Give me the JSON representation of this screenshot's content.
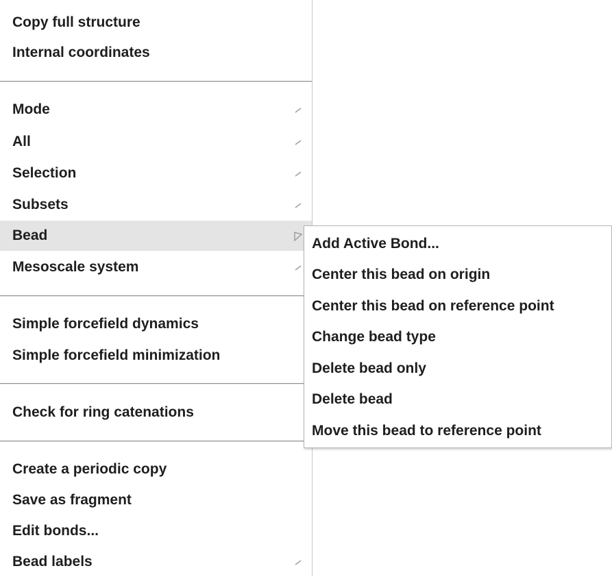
{
  "main_menu": {
    "items": [
      {
        "label": "Copy full structure"
      },
      {
        "label": "Internal coordinates"
      },
      {
        "label": "Mode",
        "submenu": true
      },
      {
        "label": "All",
        "submenu": true
      },
      {
        "label": "Selection",
        "submenu": true
      },
      {
        "label": "Subsets",
        "submenu": true
      },
      {
        "label": "Bead",
        "submenu": true,
        "highlighted": true
      },
      {
        "label": "Mesoscale system",
        "submenu": true
      },
      {
        "label": "Simple forcefield dynamics"
      },
      {
        "label": "Simple forcefield minimization"
      },
      {
        "label": "Check for ring catenations"
      },
      {
        "label": "Create a periodic copy"
      },
      {
        "label": "Save as fragment"
      },
      {
        "label": "Edit bonds..."
      },
      {
        "label": "Bead labels",
        "submenu": true
      }
    ]
  },
  "bead_submenu": {
    "items": [
      {
        "label": "Add Active Bond..."
      },
      {
        "label": "Center this bead on origin"
      },
      {
        "label": "Center this bead on reference point"
      },
      {
        "label": "Change bead type"
      },
      {
        "label": "Delete bead only"
      },
      {
        "label": "Delete bead"
      },
      {
        "label": "Move this bead to reference point"
      }
    ]
  },
  "colors": {
    "text": "#1e1e1e",
    "highlight": "#e4e4e4",
    "separator": "#8e8e8e",
    "arrow": "#a0a0a0"
  }
}
